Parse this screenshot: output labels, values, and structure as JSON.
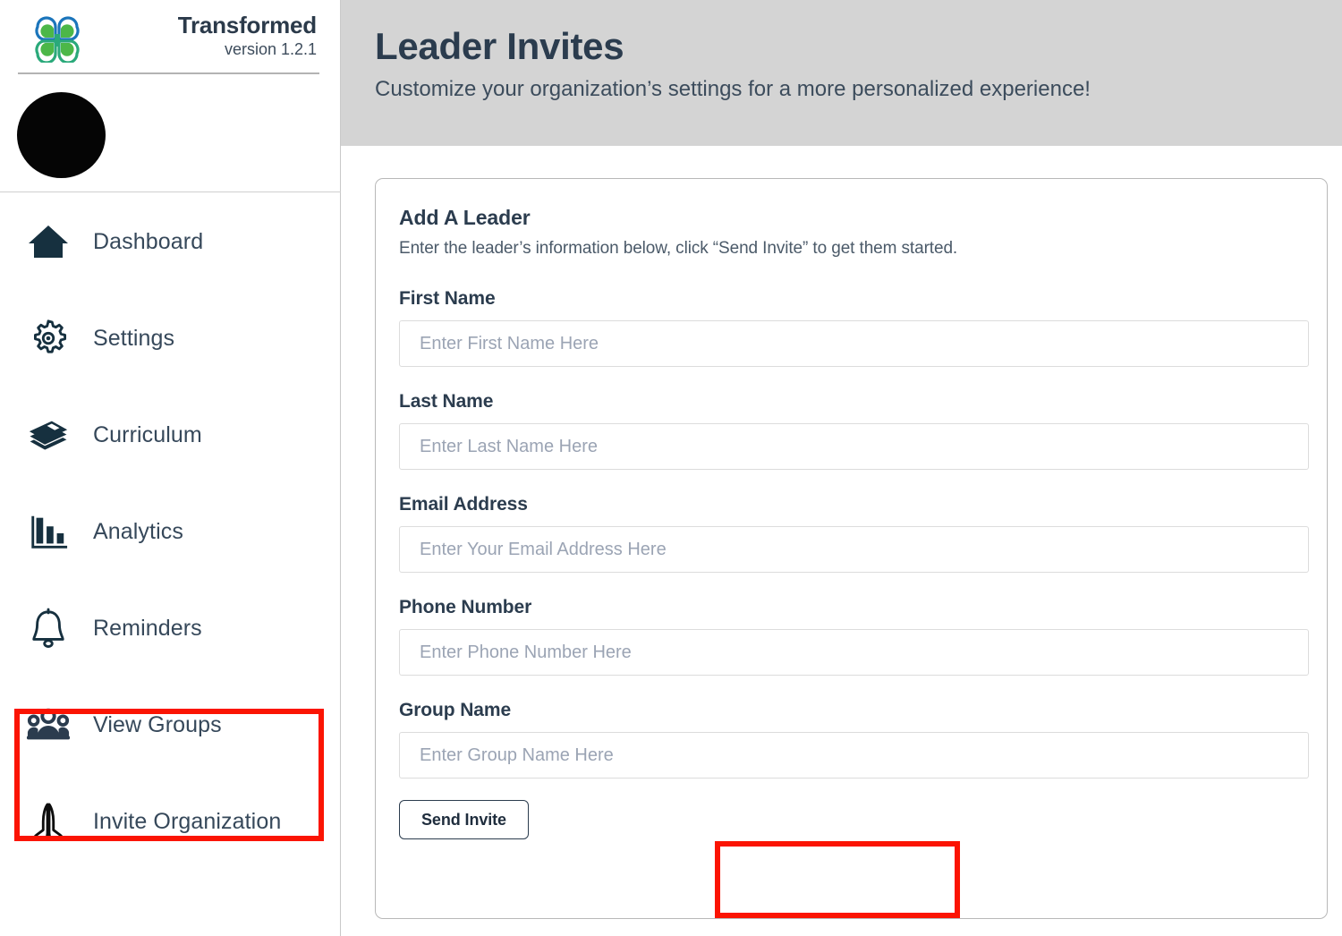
{
  "brand": {
    "logo_icon": "four-leaf-butterfly-logo",
    "title": "Transformed",
    "version": "version 1.2.1",
    "logo_colors": {
      "blue": "#1b75bb",
      "green": "#39b54a",
      "teal": "#0f9b7f"
    }
  },
  "avatar": {
    "icon": "avatar",
    "color": "#050505"
  },
  "sidebar": {
    "items": [
      {
        "label": "Dashboard",
        "icon": "home-icon"
      },
      {
        "label": "Settings",
        "icon": "gear-icon"
      },
      {
        "label": "Curriculum",
        "icon": "books-icon"
      },
      {
        "label": "Analytics",
        "icon": "bar-chart-icon"
      },
      {
        "label": "Reminders",
        "icon": "bell-icon"
      },
      {
        "label": "View Groups",
        "icon": "people-group-icon"
      },
      {
        "label": "Invite Organization",
        "icon": "praying-hands-icon"
      }
    ]
  },
  "header": {
    "title": "Leader Invites",
    "subtitle": "Customize your organization’s settings for a more personalized experience!",
    "background": "#d4d4d4",
    "text_color": "#2b3c4e"
  },
  "card": {
    "title": "Add A Leader",
    "description": "Enter the leader’s information below, click “Send Invite” to get them started.",
    "fields": [
      {
        "label": "First Name",
        "placeholder": "Enter First Name Here",
        "value": ""
      },
      {
        "label": "Last Name",
        "placeholder": "Enter Last Name Here",
        "value": ""
      },
      {
        "label": "Email Address",
        "placeholder": "Enter Your Email Address Here",
        "value": ""
      },
      {
        "label": "Phone Number",
        "placeholder": "Enter Phone Number Here",
        "value": ""
      },
      {
        "label": "Group Name",
        "placeholder": "Enter Group Name Here",
        "value": ""
      }
    ],
    "submit_label": "Send Invite"
  },
  "annotations": {
    "color": "#fb1403",
    "boxes": [
      {
        "target": "View Groups"
      },
      {
        "target": "Send Invite"
      }
    ]
  }
}
